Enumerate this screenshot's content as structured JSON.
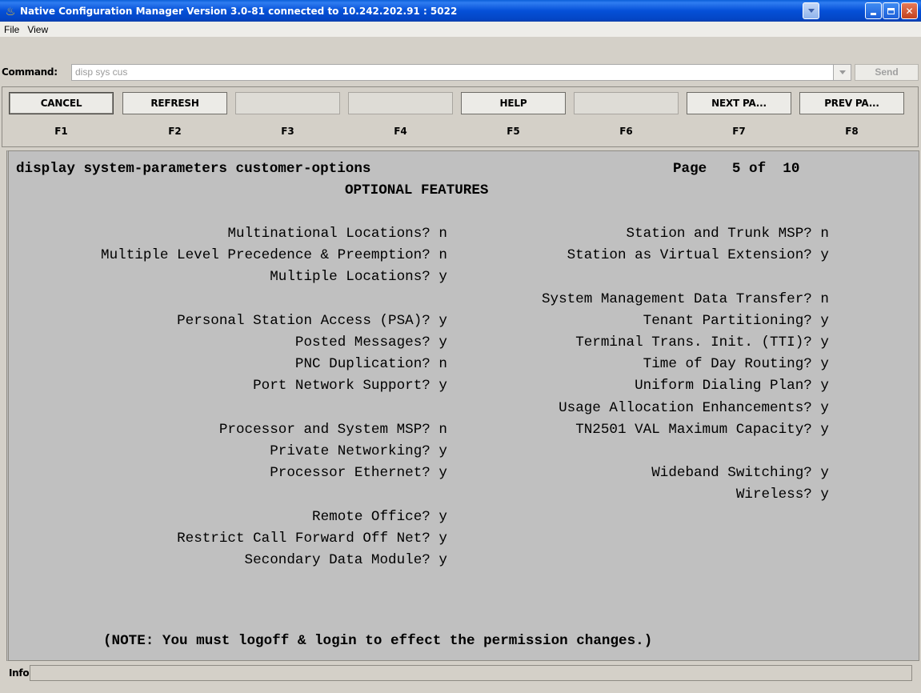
{
  "window": {
    "title": "Native Configuration Manager Version 3.0-81 connected to 10.242.202.91 : 5022"
  },
  "menu": [
    "File",
    "View"
  ],
  "command": {
    "label": "Command:",
    "value": "disp sys cus",
    "send_label": "Send"
  },
  "fkeys": [
    {
      "label": "CANCEL",
      "key": "F1"
    },
    {
      "label": "REFRESH",
      "key": "F2"
    },
    {
      "label": "",
      "key": "F3"
    },
    {
      "label": "",
      "key": "F4"
    },
    {
      "label": "HELP",
      "key": "F5"
    },
    {
      "label": "",
      "key": "F6"
    },
    {
      "label": "NEXT PA...",
      "key": "F7"
    },
    {
      "label": "PREV PA...",
      "key": "F8"
    }
  ],
  "screen": {
    "command": "display system-parameters customer-options",
    "page_label": "Page",
    "page_current": "5",
    "page_of": "of",
    "page_total": "10",
    "heading": "OPTIONAL FEATURES",
    "left_options": [
      {
        "label": "Multinational Locations?",
        "value": "n"
      },
      {
        "label": "Multiple Level Precedence & Preemption?",
        "value": "n"
      },
      {
        "label": "Multiple Locations?",
        "value": "y"
      },
      {
        "label": "Personal Station Access (PSA)?",
        "value": "y"
      },
      {
        "label": "Posted Messages?",
        "value": "y"
      },
      {
        "label": "PNC Duplication?",
        "value": "n"
      },
      {
        "label": "Port Network Support?",
        "value": "y"
      },
      {
        "label": "Processor and System MSP?",
        "value": "n"
      },
      {
        "label": "Private Networking?",
        "value": "y"
      },
      {
        "label": "Processor Ethernet?",
        "value": "y"
      },
      {
        "label": "Remote Office?",
        "value": "y"
      },
      {
        "label": "Restrict Call Forward Off Net?",
        "value": "y"
      },
      {
        "label": "Secondary Data Module?",
        "value": "y"
      }
    ],
    "right_options": [
      {
        "label": "Station and Trunk MSP?",
        "value": "n"
      },
      {
        "label": "Station as Virtual Extension?",
        "value": "y"
      },
      {
        "label": "System Management Data Transfer?",
        "value": "n"
      },
      {
        "label": "Tenant Partitioning?",
        "value": "y"
      },
      {
        "label": "Terminal Trans. Init. (TTI)?",
        "value": "y"
      },
      {
        "label": "Time of Day Routing?",
        "value": "y"
      },
      {
        "label": "Uniform Dialing Plan?",
        "value": "y"
      },
      {
        "label": "Usage Allocation Enhancements?",
        "value": "y"
      },
      {
        "label": "TN2501 VAL Maximum Capacity?",
        "value": "y"
      },
      {
        "label": "Wideband Switching?",
        "value": "y"
      },
      {
        "label": "Wireless?",
        "value": "y"
      }
    ],
    "note": "(NOTE: You must logoff & login to effect the permission changes.)"
  },
  "info": {
    "label": "Info:",
    "value": ""
  },
  "colors": {
    "titlebar": "#0550d8",
    "screen_bg": "#c0c0c0",
    "chrome_bg": "#d4d0c8"
  }
}
